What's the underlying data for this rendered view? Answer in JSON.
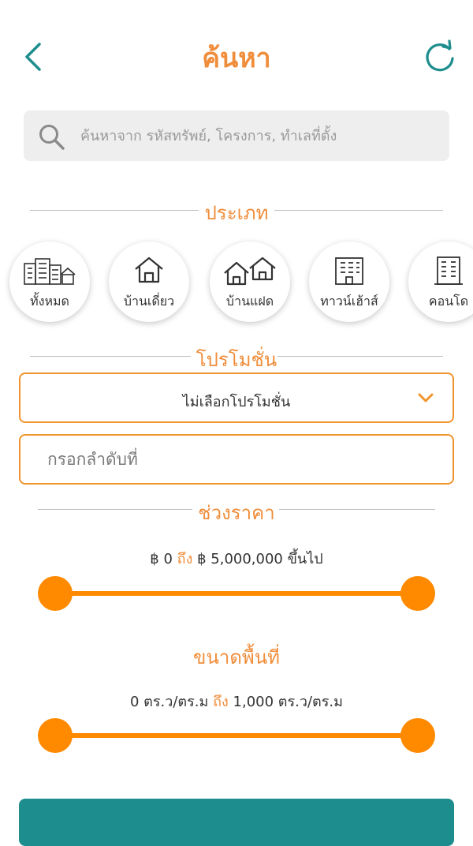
{
  "header": {
    "title": "ค้นหา",
    "back_icon": "chevron-left-icon",
    "refresh_icon": "refresh-icon"
  },
  "search": {
    "placeholder": "ค้นหาจาก รหัสทรัพย์, โครงการ, ทำเลที่ตั้ง",
    "value": ""
  },
  "type_section": {
    "title": "ประเภท",
    "items": [
      {
        "label": "ทั้งหมด",
        "icon": "buildings-icon"
      },
      {
        "label": "บ้านเดี่ยว",
        "icon": "house-icon"
      },
      {
        "label": "บ้านแฝด",
        "icon": "twin-house-icon"
      },
      {
        "label": "ทาวน์เฮ้าส์",
        "icon": "townhouse-icon"
      },
      {
        "label": "คอนโด",
        "icon": "condo-icon"
      }
    ]
  },
  "promotion_section": {
    "title": "โปรโมชั่น",
    "selected": "ไม่เลือกโปรโมชั่น",
    "order_placeholder": "กรอกลำดับที่"
  },
  "price_section": {
    "title": "ช่วงราคา",
    "min": "฿ 0",
    "to_word": "ถึง",
    "max": "฿ 5,000,000 ขึ้นไป",
    "slider_min_fraction": 0,
    "slider_max_fraction": 1
  },
  "area_section": {
    "title": "ขนาดพื้นที่",
    "min": "0 ตร.ว/ตร.ม",
    "to_word": "ถึง",
    "max": "1,000 ตร.ว/ตร.ม",
    "slider_min_fraction": 0,
    "slider_max_fraction": 1
  },
  "colors": {
    "accent": "#f08d3a",
    "slider": "#ff8a00",
    "teal": "#1e8d8d"
  }
}
